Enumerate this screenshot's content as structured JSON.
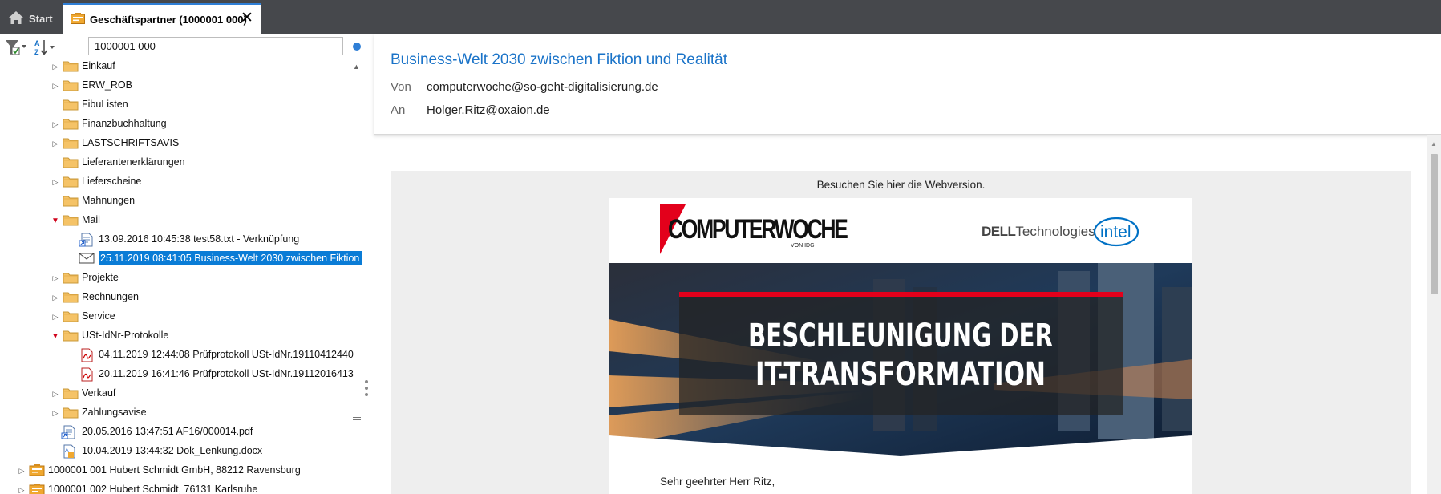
{
  "tabs": [
    {
      "label": "Start",
      "icon": "home-icon"
    },
    {
      "label": "Geschäftspartner (1000001 000)",
      "icon": "business-partner-icon",
      "active": true
    }
  ],
  "search": {
    "value": "1000001 000"
  },
  "tree": [
    {
      "label": "Einkauf",
      "type": "folder",
      "expander": "collapsed"
    },
    {
      "label": "ERW_ROB",
      "type": "folder",
      "expander": "collapsed"
    },
    {
      "label": "FibuListen",
      "type": "folder",
      "expander": "none"
    },
    {
      "label": "Finanzbuchhaltung",
      "type": "folder",
      "expander": "collapsed"
    },
    {
      "label": "LASTSCHRIFTSAVIS",
      "type": "folder",
      "expander": "collapsed"
    },
    {
      "label": "Lieferantenerklärungen",
      "type": "folder",
      "expander": "none"
    },
    {
      "label": "Lieferscheine",
      "type": "folder",
      "expander": "collapsed"
    },
    {
      "label": "Mahnungen",
      "type": "folder",
      "expander": "none"
    },
    {
      "label": "Mail",
      "type": "folder",
      "expander": "expanded"
    },
    {
      "label": "13.09.2016 10:45:38 test58.txt - Verknüpfung",
      "type": "link-doc",
      "expander": "none"
    },
    {
      "label": "25.11.2019 08:41:05 Business-Welt 2030 zwischen Fiktion",
      "type": "mail",
      "expander": "none",
      "selected": true
    },
    {
      "label": "Projekte",
      "type": "folder",
      "expander": "collapsed"
    },
    {
      "label": "Rechnungen",
      "type": "folder",
      "expander": "collapsed"
    },
    {
      "label": "Service",
      "type": "folder",
      "expander": "collapsed"
    },
    {
      "label": "USt-IdNr-Protokolle",
      "type": "folder",
      "expander": "expanded"
    },
    {
      "label": "04.11.2019 12:44:08 Prüfprotokoll USt-IdNr.19110412440",
      "type": "pdf",
      "expander": "none"
    },
    {
      "label": "20.11.2019 16:41:46 Prüfprotokoll USt-IdNr.19112016413",
      "type": "pdf",
      "expander": "none"
    },
    {
      "label": "Verkauf",
      "type": "folder",
      "expander": "collapsed"
    },
    {
      "label": "Zahlungsavise",
      "type": "folder",
      "expander": "collapsed"
    },
    {
      "label": "20.05.2016 13:47:51 AF16/000014.pdf",
      "type": "link-doc",
      "expander": "none"
    },
    {
      "label": "10.04.2019 13:44:32 Dok_Lenkung.docx",
      "type": "word-doc",
      "expander": "none"
    },
    {
      "label": "1000001 001 Hubert Schmidt GmbH, 88212 Ravensburg",
      "type": "partner",
      "expander": "collapsed"
    },
    {
      "label": "1000001 002 Hubert Schmidt, 76131 Karlsruhe",
      "type": "partner",
      "expander": "collapsed"
    }
  ],
  "mail": {
    "subject": "Business-Welt 2030 zwischen Fiktion und Realität",
    "from_label": "Von",
    "from": "computerwoche@so-geht-digitalisierung.de",
    "to_label": "An",
    "to": "Holger.Ritz@oxaion.de"
  },
  "newsletter": {
    "webversion_link": "Besuchen Sie hier die Webversion.",
    "brand": "COMPUTERWOCHE",
    "brand_sub": "VON IDG",
    "partner_dell_bold": "DELL",
    "partner_dell_rest": "Technologies",
    "partner_intel": "intel",
    "banner_line1": "BESCHLEUNIGUNG DER",
    "banner_line2": "IT-TRANSFORMATION",
    "greeting": "Sehr geehrter Herr Ritz,"
  },
  "colors": {
    "accent": "#0a7cd6",
    "subject": "#1a73c8",
    "brand_red": "#e3001b"
  }
}
